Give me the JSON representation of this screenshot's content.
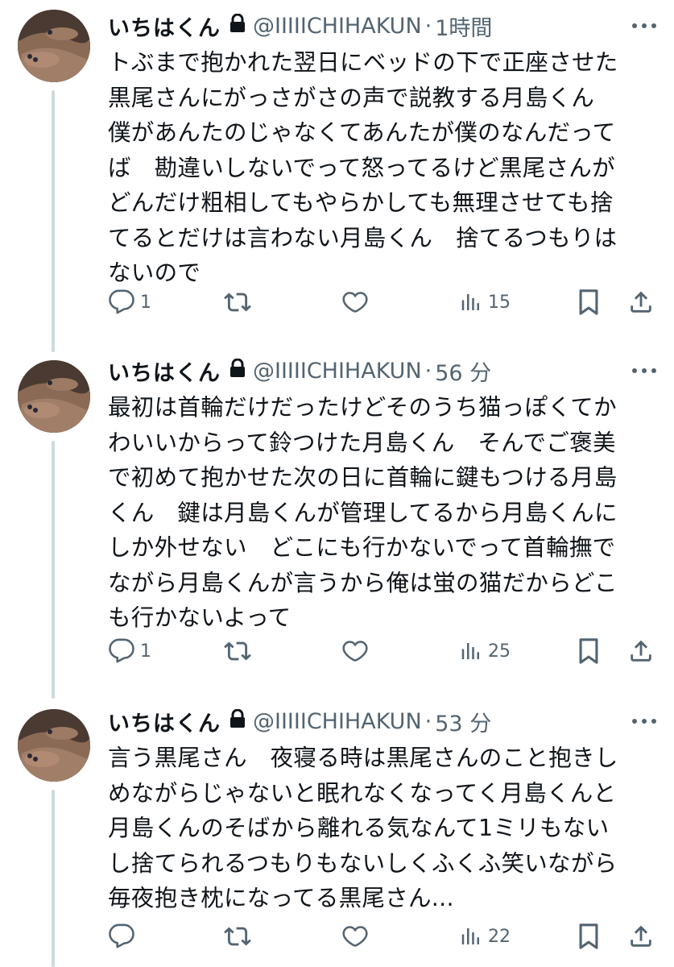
{
  "tweets": [
    {
      "name": "いちはくん",
      "handle": "@IIIIICHIHAKUN",
      "dot": "·",
      "time": "1時間",
      "text": "トぶまで抱かれた翌日にベッドの下で正座させた\n黒尾さんにがっさがさの声で説教する月島くん\n僕があんたのじゃなくてあんたが僕のなんだって\nば　勘違いしないでって怒ってるけど黒尾さんが\nどんだけ粗相してもやらかしても無理させても捨\nてるとだけは言わない月島くん　捨てるつもりは\nないので",
      "replies": "1",
      "retweets": "",
      "likes": "",
      "views": "15"
    },
    {
      "name": "いちはくん",
      "handle": "@IIIIICHIHAKUN",
      "dot": "·",
      "time": "56 分",
      "text": "最初は首輪だけだったけどそのうち猫っぽくてか\nわいいからって鈴つけた月島くん　そんでご褒美\nで初めて抱かせた次の日に首輪に鍵もつける月島\nくん　鍵は月島くんが管理してるから月島くんに\nしか外せない　どこにも行かないでって首輪撫で\nながら月島くんが言うから俺は蛍の猫だからどこ\nも行かないよって",
      "replies": "1",
      "retweets": "",
      "likes": "",
      "views": "25"
    },
    {
      "name": "いちはくん",
      "handle": "@IIIIICHIHAKUN",
      "dot": "·",
      "time": "53 分",
      "text": "言う黒尾さん　夜寝る時は黒尾さんのこと抱きし\nめながらじゃないと眠れなくなってく月島くんと\n月島くんのそばから離れる気なんて1ミリもない\nし捨てられるつもりもないしくふくふ笑いながら\n毎夜抱き枕になってる黒尾さん...",
      "replies": "",
      "retweets": "",
      "likes": "",
      "views": "22"
    }
  ],
  "colors": {
    "text": "#0f1419",
    "secondary": "#536471",
    "thread": "#cfd9de"
  }
}
